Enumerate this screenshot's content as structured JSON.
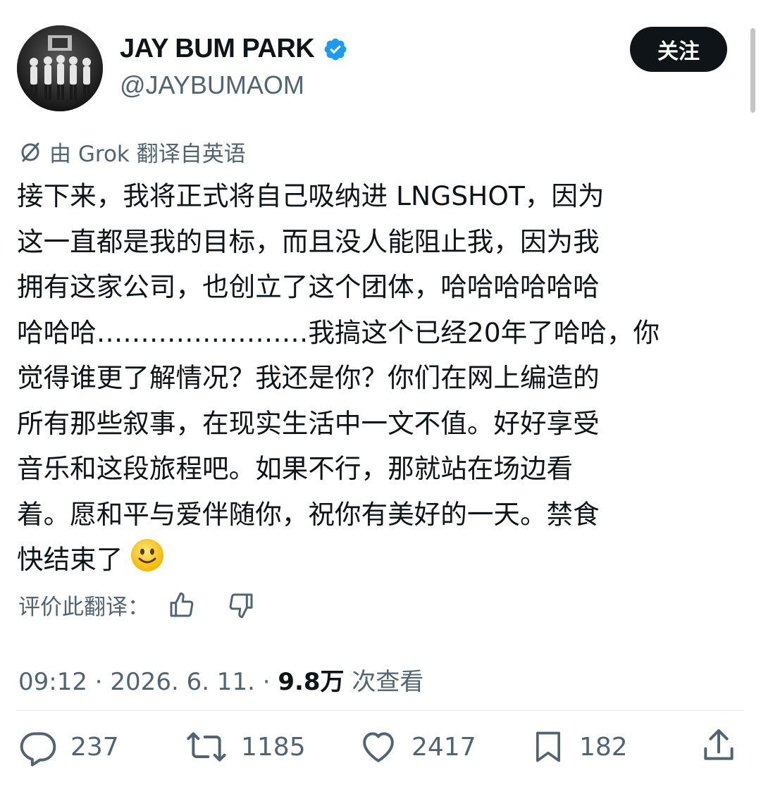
{
  "author": {
    "display_name": "JAY BUM PARK",
    "handle": "@JAYBUMAOM",
    "verified": true,
    "verified_color": "#1d9bf0"
  },
  "follow_button": {
    "label": "关注"
  },
  "translation": {
    "label": "由 Grok 翻译自英语",
    "icon": "no-translate-icon"
  },
  "tweet": {
    "lines": [
      "接下来，我将正式将自己吸纳进 LNGSHOT，因为",
      "这一直都是我的目标，而且没人能阻止我，因为我",
      "拥有这家公司，也创立了这个团体，哈哈哈哈哈哈",
      "哈哈哈……………………我搞这个已经20年了哈哈，你",
      "觉得谁更了解情况？我还是你？你们在网上编造的",
      "所有那些叙事，在现实生活中一文不值。好好享受",
      "音乐和这段旅程吧。如果不行，那就站在场边看",
      "着。愿和平与爱伴随你，祝你有美好的一天。禁食",
      "快结束了"
    ],
    "emoji": "slightly-smiling-face"
  },
  "rate_translation": {
    "label": "评价此翻译：",
    "like_icon": "thumbs-up-icon",
    "dislike_icon": "thumbs-down-icon"
  },
  "meta": {
    "time": "09:12",
    "separator": " · ",
    "date": "2026. 6. 11.",
    "views_count": "9.8万",
    "views_label": " 次查看"
  },
  "actions": {
    "replies": "237",
    "reposts": "1185",
    "likes": "2417",
    "bookmarks": "182",
    "icons": [
      "reply-icon",
      "repost-icon",
      "like-icon",
      "bookmark-icon",
      "share-icon"
    ]
  },
  "colors": {
    "text_primary": "#0f1419",
    "text_secondary": "#536471",
    "follow_bg": "#0f1419",
    "follow_text": "#ffffff"
  }
}
